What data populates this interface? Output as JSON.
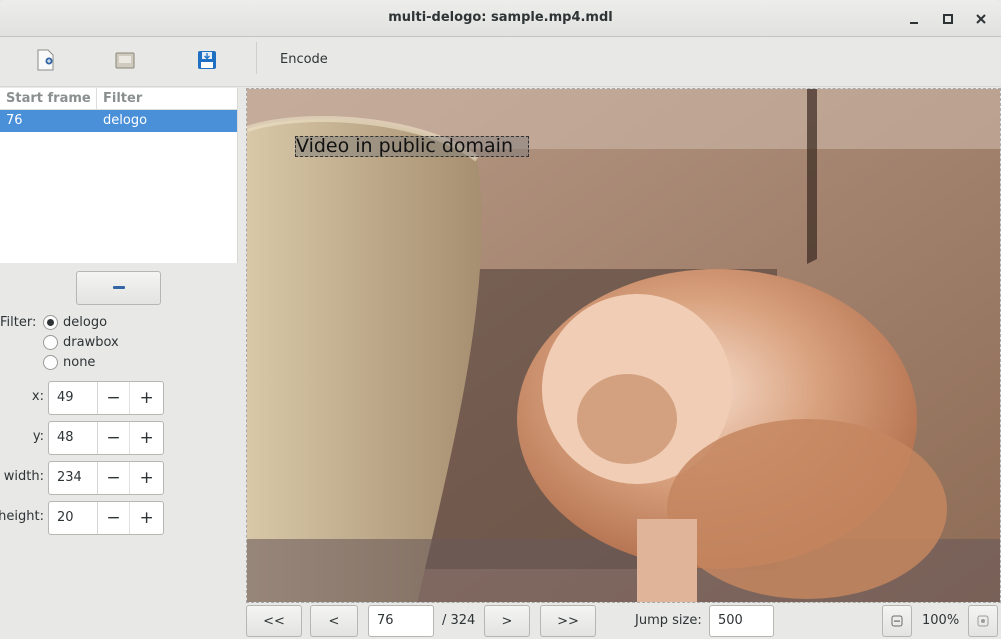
{
  "window": {
    "title": "multi-delogo: sample.mp4.mdl"
  },
  "toolbar": {
    "encode_label": "Encode"
  },
  "list": {
    "headers": [
      "Start frame",
      "Filter"
    ],
    "rows": [
      {
        "start_frame": "76",
        "filter": "delogo"
      }
    ]
  },
  "filter": {
    "label": "Filter:",
    "options": [
      "delogo",
      "drawbox",
      "none"
    ],
    "selected": "delogo"
  },
  "params": {
    "x": {
      "label": "x:",
      "value": "49"
    },
    "y": {
      "label": "y:",
      "value": "48"
    },
    "width": {
      "label": "width:",
      "value": "234"
    },
    "height": {
      "label": "height:",
      "value": "20"
    }
  },
  "video": {
    "overlay_text": "Video in public domain"
  },
  "navigation": {
    "first": "<<",
    "prev": "<",
    "next": ">",
    "last": ">>",
    "frame": "76",
    "total": "/ 324",
    "jump_label": "Jump size:",
    "jump_value": "500",
    "zoom": "100%"
  },
  "colors": {
    "selection": "#4a90d9",
    "save_icon": "#1f6fc2"
  }
}
